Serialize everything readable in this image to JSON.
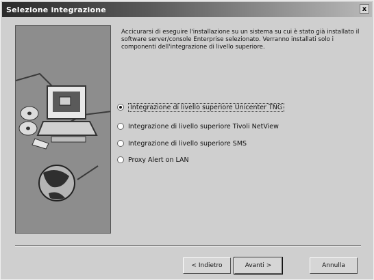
{
  "window": {
    "title": "Selezione integrazione",
    "close_glyph": "x"
  },
  "intro_text": "Accicurarsi di eseguire l'installazione su un sistema su cui è stato già installato il software server/console Enterprise selezionato. Verranno installati solo i componenti dell'integrazione di livello superiore.",
  "options": [
    {
      "label": "Integrazione di livello superiore Unicenter TNG",
      "checked": true
    },
    {
      "label": "Integrazione di livello superiore Tivoli NetView",
      "checked": false
    },
    {
      "label": "Integrazione di livello superiore SMS",
      "checked": false
    },
    {
      "label": "Proxy Alert on LAN",
      "checked": false
    }
  ],
  "buttons": {
    "back": "< Indietro",
    "next": "Avanti >",
    "cancel": "Annulla"
  },
  "art_icons": [
    "computer-icon",
    "disk-icon",
    "globe-icon"
  ]
}
